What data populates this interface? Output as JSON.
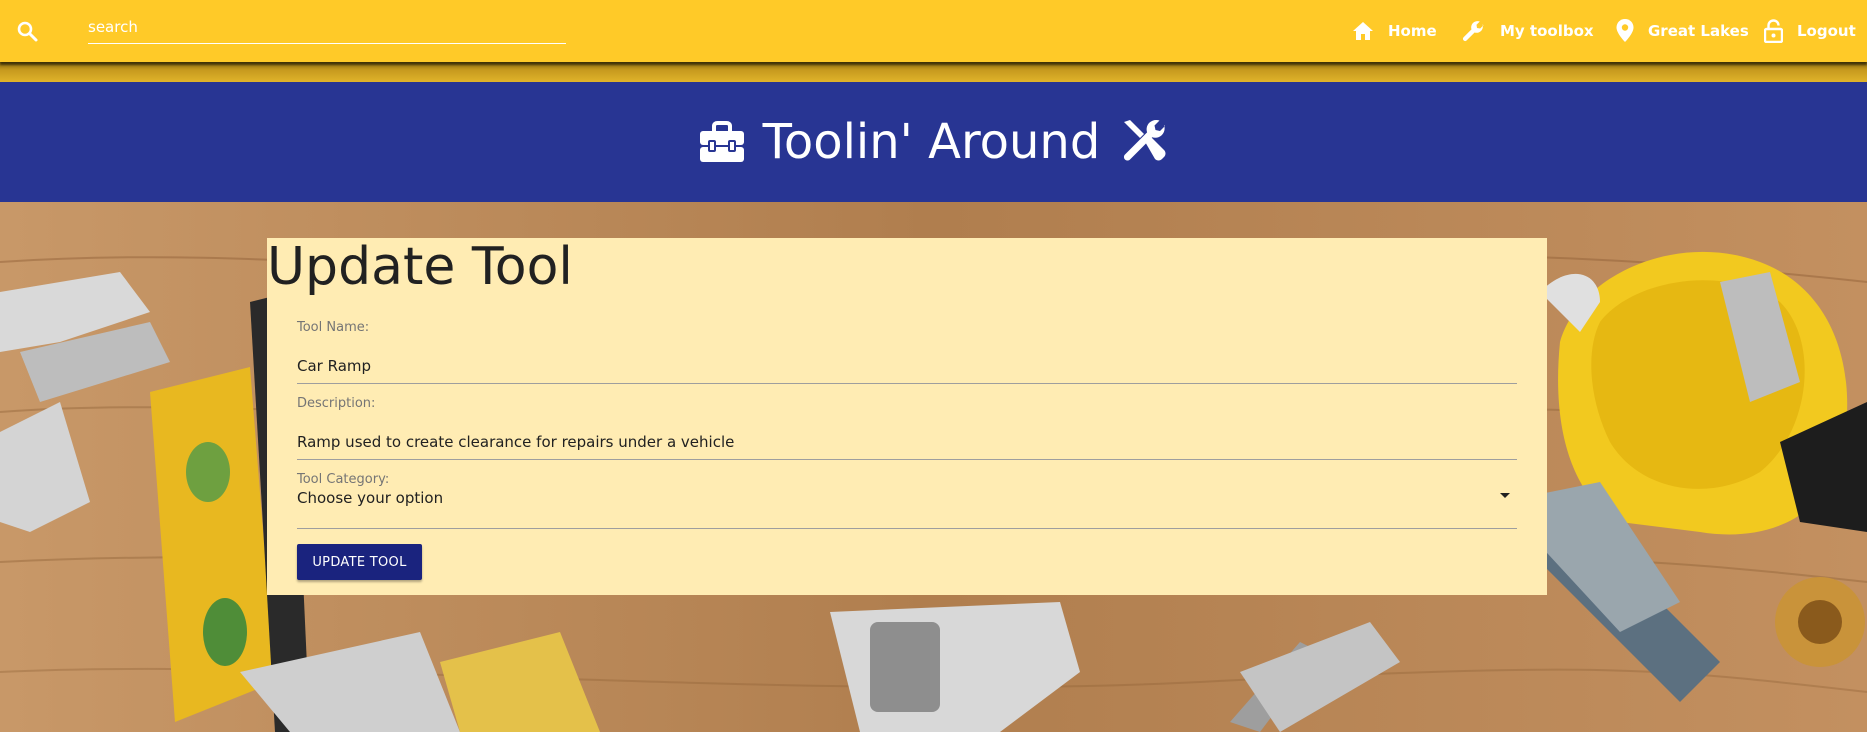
{
  "topnav": {
    "search": {
      "placeholder": "search"
    },
    "links": [
      {
        "label": "Home",
        "icon": "home-icon"
      },
      {
        "label": "My toolbox",
        "icon": "wrench-icon"
      },
      {
        "label": "Great Lakes",
        "icon": "location-pin-icon"
      },
      {
        "label": "Logout",
        "icon": "lock-icon"
      }
    ]
  },
  "banner": {
    "title": "Toolin' Around",
    "left_icon": "toolbox-icon",
    "right_icon": "tools-icon"
  },
  "form": {
    "title": "Update Tool",
    "tool_name": {
      "label": "Tool Name:",
      "value": "Car Ramp"
    },
    "description": {
      "label": "Description:",
      "value": "Ramp used to create clearance for repairs under a vehicle"
    },
    "category": {
      "label": "Tool Category:",
      "selected": "Choose your option"
    },
    "submit_label": "UPDATE TOOL"
  },
  "colors": {
    "nav_bg": "#ffca28",
    "banner_bg": "#283593",
    "card_bg": "#ffecb3",
    "button_bg": "#1a237e"
  }
}
